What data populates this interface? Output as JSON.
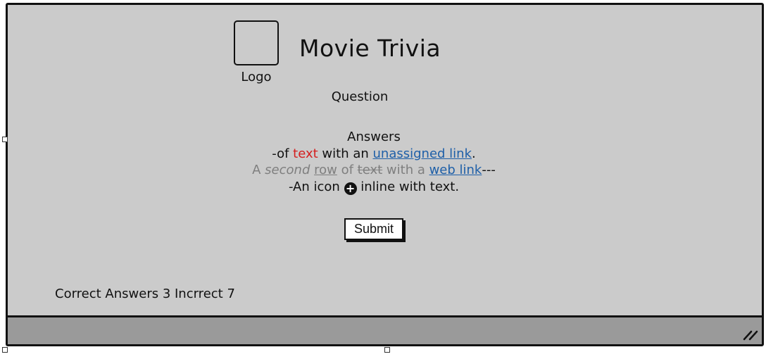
{
  "app": {
    "logo_label": "Logo",
    "title": "Movie Trivia"
  },
  "quiz": {
    "question": "Question",
    "answers_heading": "Answers",
    "line1": {
      "prefix": "-of ",
      "red_text": "text",
      "middle": " with an ",
      "link_text": "unassigned link",
      "suffix": "."
    },
    "line2": {
      "a": "A ",
      "italic": "second",
      "space1": " ",
      "underlined": "row",
      "of": " of ",
      "struck": "text",
      "with": " with a ",
      "link_text": "web link",
      "suffix": "---"
    },
    "line3": {
      "prefix": "-An icon ",
      "icon": "plus-circle-icon",
      "suffix": " inline with text."
    },
    "submit_label": "Submit"
  },
  "score": {
    "text": "Correct Answers 3 Incrrect 7"
  },
  "colors": {
    "background": "#cbcbcb",
    "statusbar": "#9a9a9a",
    "red_text": "#d42020",
    "link": "#1e5fa8",
    "muted": "#7f7f7f"
  }
}
